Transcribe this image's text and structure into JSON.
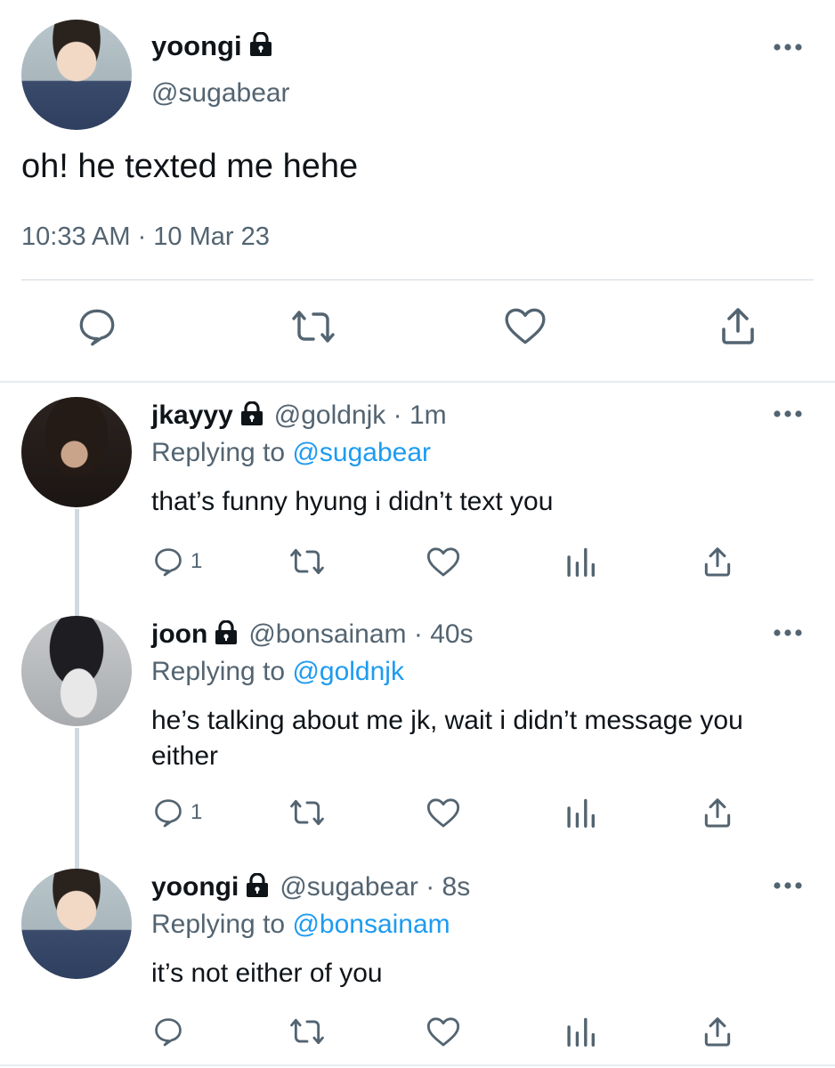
{
  "main_tweet": {
    "display_name": "yoongi",
    "handle": "@sugabear",
    "text": "oh! he texted me hehe",
    "meta": "10:33 AM · 10 Mar 23",
    "avatar": "avatar-photo"
  },
  "replies": [
    {
      "display_name": "jkayyy",
      "handle_time": "@goldnjk · 1m",
      "replying_label": "Replying to",
      "replying_to": "@sugabear",
      "text": "that’s funny hyung i didn’t text you",
      "reply_count": "1"
    },
    {
      "display_name": "joon",
      "handle_time": "@bonsainam · 40s",
      "replying_label": "Replying to",
      "replying_to": "@goldnjk",
      "text": "he’s talking about me jk, wait i didn’t message you either",
      "reply_count": "1"
    },
    {
      "display_name": "yoongi",
      "handle_time": "@sugabear · 8s",
      "replying_label": "Replying to",
      "replying_to": "@bonsainam",
      "text": "it’s not either of you",
      "reply_count": ""
    }
  ],
  "icons": [
    "lock-icon",
    "more-icon",
    "reply-icon",
    "retweet-icon",
    "like-icon",
    "share-icon",
    "analytics-icon"
  ],
  "colors": {
    "text": "#0f1419",
    "secondary": "#536471",
    "link": "#1d9bf0",
    "divider": "#cfd9de"
  }
}
